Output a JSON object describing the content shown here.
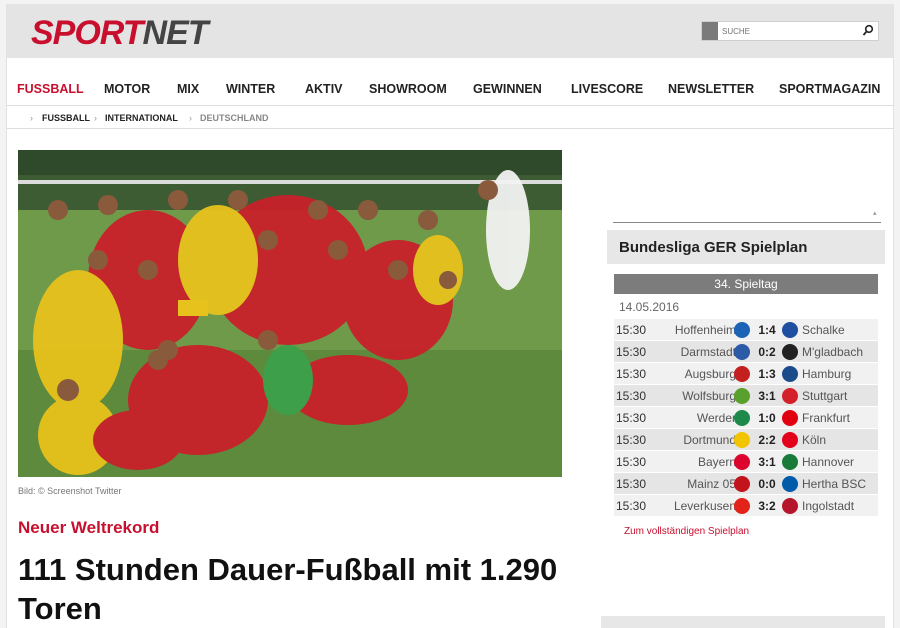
{
  "logo": {
    "part1": "SPORT",
    "part2": "NET"
  },
  "search": {
    "placeholder": "SUCHE"
  },
  "nav": [
    "FUSSBALL",
    "MOTOR",
    "MIX",
    "WINTER",
    "AKTIV",
    "SHOWROOM",
    "GEWINNEN",
    "LIVESCORE",
    "NEWSLETTER",
    "SPORTMAGAZIN"
  ],
  "breadcrumb": [
    "FUSSBALL",
    "INTERNATIONAL",
    "DEUTSCHLAND"
  ],
  "article": {
    "caption": "Bild: © Screenshot Twitter",
    "kicker": "Neuer Weltrekord",
    "headline": "111 Stunden Dauer-Fußball mit 1.290 Toren"
  },
  "widget": {
    "title": "Bundesliga GER Spielplan",
    "matchday": "34. Spieltag",
    "date": "14.05.2016",
    "link": "Zum vollständigen Spielplan",
    "games": [
      {
        "time": "15:30",
        "home": "Hoffenheim",
        "score": "1:4",
        "away": "Schalke",
        "hcolor": "#1c63b7",
        "acolor": "#1f4fa0"
      },
      {
        "time": "15:30",
        "home": "Darmstadt",
        "score": "0:2",
        "away": "M'gladbach",
        "hcolor": "#2b5aa6",
        "acolor": "#222222"
      },
      {
        "time": "15:30",
        "home": "Augsburg",
        "score": "1:3",
        "away": "Hamburg",
        "hcolor": "#c3201f",
        "acolor": "#1a4c8c"
      },
      {
        "time": "15:30",
        "home": "Wolfsburg",
        "score": "3:1",
        "away": "Stuttgart",
        "hcolor": "#5aa02c",
        "acolor": "#d4202a"
      },
      {
        "time": "15:30",
        "home": "Werder",
        "score": "1:0",
        "away": "Frankfurt",
        "hcolor": "#1d8a4c",
        "acolor": "#e1000f"
      },
      {
        "time": "15:30",
        "home": "Dortmund",
        "score": "2:2",
        "away": "Köln",
        "hcolor": "#f2c500",
        "acolor": "#e3001b"
      },
      {
        "time": "15:30",
        "home": "Bayern",
        "score": "3:1",
        "away": "Hannover",
        "hcolor": "#dc052d",
        "acolor": "#1a7b39"
      },
      {
        "time": "15:30",
        "home": "Mainz 05",
        "score": "0:0",
        "away": "Hertha BSC",
        "hcolor": "#c3141e",
        "acolor": "#005ca9"
      },
      {
        "time": "15:30",
        "home": "Leverkusen",
        "score": "3:2",
        "away": "Ingolstadt",
        "hcolor": "#e32219",
        "acolor": "#b5162b"
      }
    ]
  }
}
